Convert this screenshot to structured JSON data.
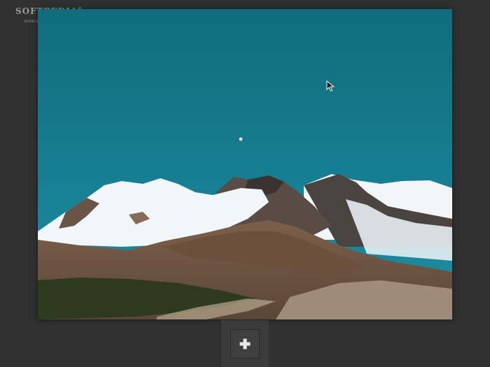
{
  "watermark": {
    "brand": "SOFTPEDIA",
    "registered_mark": "®",
    "url": "www.softpedia.com"
  },
  "photo": {
    "icon": "mountain-landscape-photo",
    "colors": {
      "sky_top": "#0f6b7b",
      "sky_bottom": "#1b8aa0",
      "snow": "#eef5f8",
      "rock_dark": "#4a4340",
      "rock_brown": "#7a5c48",
      "foreground_brown": "#8a6c55",
      "forest": "#2e3a1f"
    }
  },
  "toolbar": {
    "add_icon": "plus-icon"
  },
  "colors": {
    "background": "#303030",
    "button_bg": "#3f3f3f",
    "icon_color": "#e8e8e8"
  }
}
